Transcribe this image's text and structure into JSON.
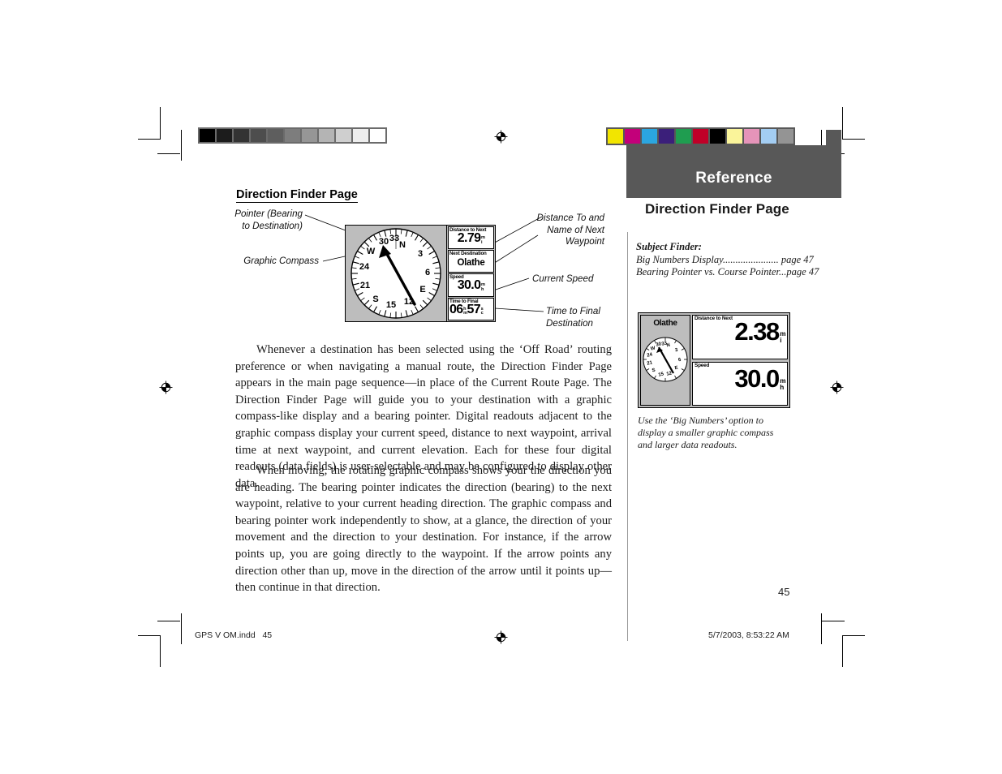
{
  "prepress": {
    "grayscale_wedge": [
      "#000000",
      "#1c1c1c",
      "#333333",
      "#4d4d4d",
      "#5e5e5e",
      "#7d7d7d",
      "#969696",
      "#b4b4b4",
      "#cfcfcf",
      "#ededed",
      "#ffffff"
    ],
    "color_bar": [
      "#f2e500",
      "#c3007a",
      "#2ba6e0",
      "#3b1f7a",
      "#1f9d50",
      "#c00028",
      "#000000",
      "#faf49a",
      "#e594b9",
      "#a3cdf2",
      "#949494"
    ],
    "registration_mark": "registration-target-icon"
  },
  "left_column": {
    "heading": "Direction Finder Page",
    "callouts": {
      "pointer": "Pointer (Bearing\nto Destination)",
      "pointer_line1": "Pointer (Bearing",
      "pointer_line2": "to Destination)",
      "graphic_compass": "Graphic Compass",
      "distance_name_line1": "Distance To and",
      "distance_name_line2": "Name of Next",
      "distance_name_line3": "Waypoint",
      "current_speed": "Current Speed",
      "time_final_line1": "Time to Final",
      "time_final_line2": "Destination"
    },
    "paragraphs": [
      "Whenever a destination has been selected using the ‘Off Road’ routing preference or when navigating a manual route, the Direction Finder Page appears in the main page sequence—in place of the Current Route Page.  The Direction Finder Page will guide you to your destination with a graphic compass-like display and a bearing pointer.  Digital readouts adjacent to the graphic compass display your current speed, distance to next waypoint, arrival time at next waypoint, and current elevation.  Each for these four digital readouts (data fields) is user-selectable and may be configured to display other data.",
      "When moving, the rotating graphic compass shows your the direction you are heading.  The bearing pointer indicates the direction (bearing) to the next waypoint, relative to your current heading direction.  The graphic compass and bearing pointer work independently to show, at a glance, the direction of your movement and the direction to your destination.  For instance, if the arrow points up, you are going directly to the waypoint.  If the arrow points any direction other than up, move in the direction of the arrow until it points up—then continue in that direction."
    ]
  },
  "gps_main_screen": {
    "compass_labels": [
      "N",
      "3",
      "6",
      "E",
      "12",
      "15",
      "S",
      "21",
      "24",
      "W",
      "30",
      "33"
    ],
    "bearing_pointer_icon": "bearing-arrow-icon",
    "fields": [
      {
        "label": "Distance to Next",
        "value": "2.79",
        "unit_top": "m",
        "unit_bottom": "i"
      },
      {
        "label": "Next Destination",
        "value": "Olathe",
        "unit_top": "",
        "unit_bottom": ""
      },
      {
        "label": "Speed",
        "value": "30.0",
        "unit_top": "m",
        "unit_bottom": "h"
      },
      {
        "label": "Time to Final",
        "value": "06:57",
        "unit_top": "m",
        "unit_bottom": "s"
      }
    ],
    "time_units": {
      "left_top": "h",
      "left_bottom": "m",
      "right_top": "s",
      "right_bottom": "c"
    }
  },
  "right_column": {
    "band_title": "Reference",
    "section_title": "Direction Finder Page",
    "subject_finder_heading": "Subject Finder:",
    "subject_finder_items": [
      "Big Numbers Display...................... page 47",
      "Bearing Pointer vs. Course Pointer...page 47"
    ],
    "big_numbers_screen": {
      "waypoint": "Olathe",
      "compass_labels": [
        "N",
        "3",
        "6",
        "E",
        "12",
        "15",
        "S",
        "21",
        "24",
        "W",
        "30",
        "33"
      ],
      "fields": [
        {
          "label": "Distance to Next",
          "value": "2.38",
          "unit_top": "m",
          "unit_bottom": "i"
        },
        {
          "label": "Speed",
          "value": "30.0",
          "unit_top": "m",
          "unit_bottom": "h"
        }
      ]
    },
    "caption": "Use the ‘Big Numbers’ option to display a smaller graphic compass and larger data readouts.",
    "page_number": "45"
  },
  "footer": {
    "left": "GPS V OM.indd   45",
    "right": "5/7/2003, 8:53:22 AM"
  }
}
